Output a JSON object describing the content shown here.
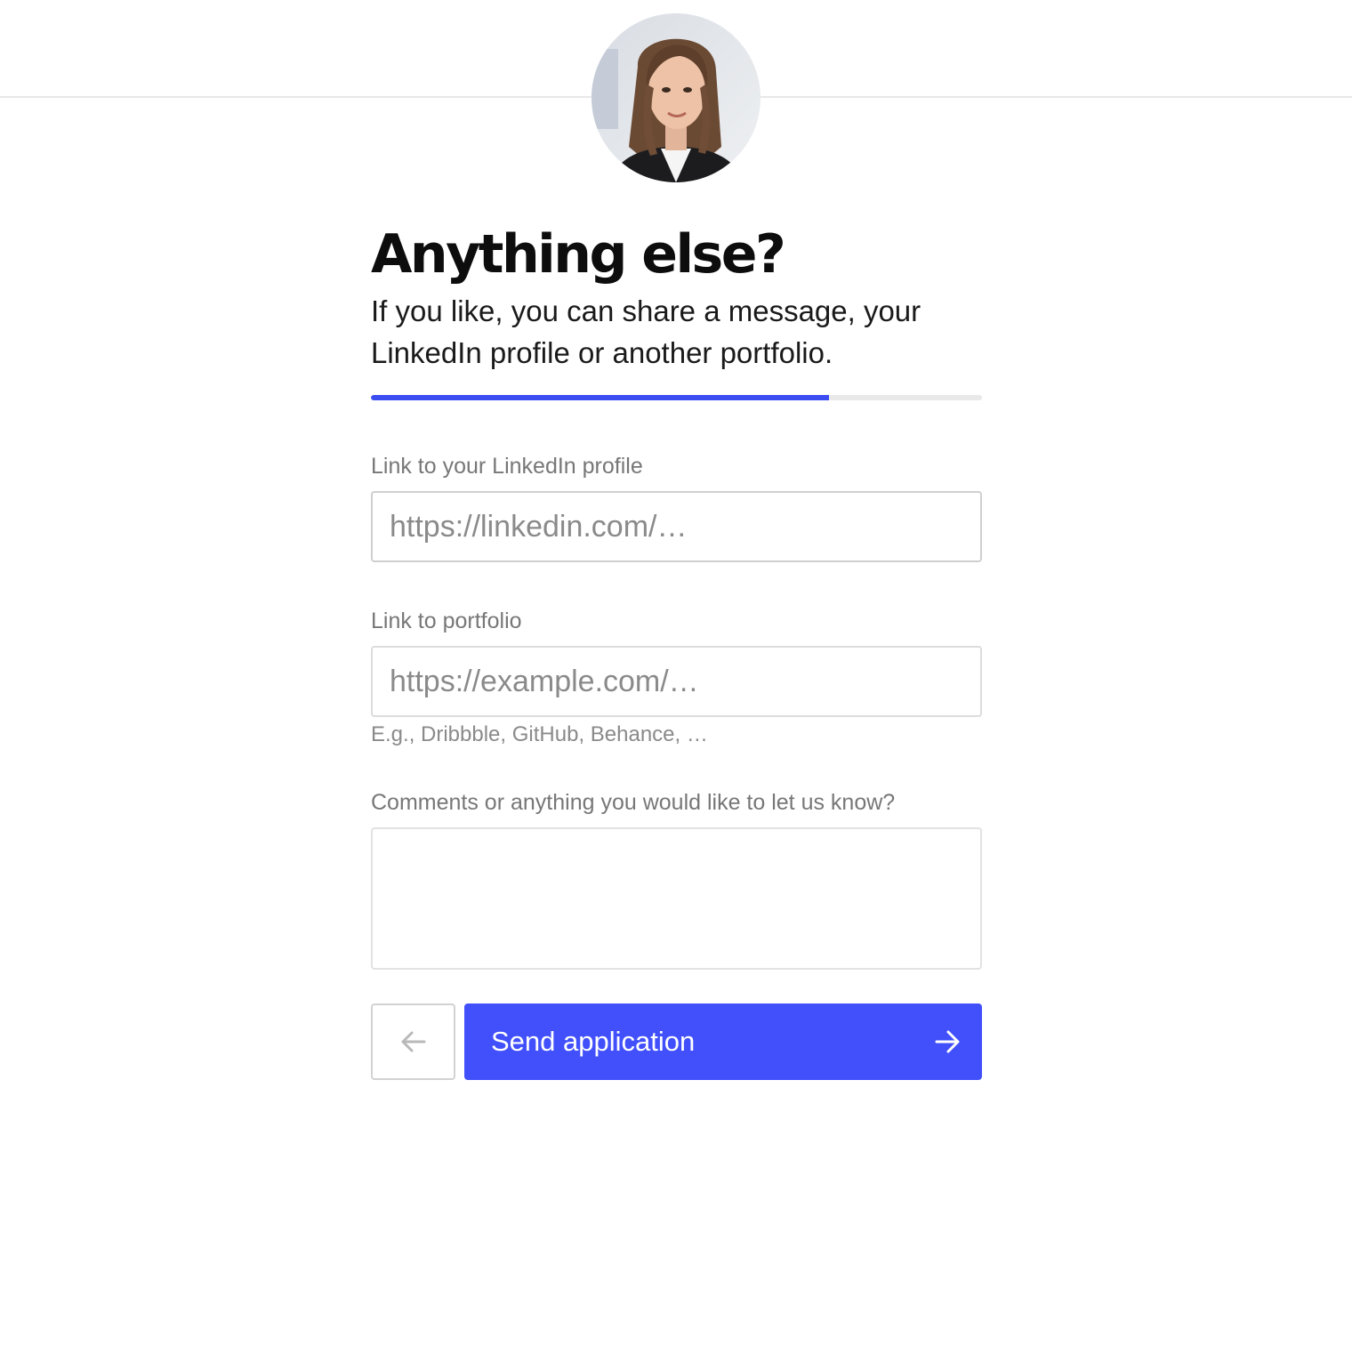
{
  "header": {
    "avatar_alt": "Recruiter portrait"
  },
  "form": {
    "title": "Anything else?",
    "subtitle": "If you like, you can share a message, your LinkedIn profile or another portfolio.",
    "progress_fraction": 0.75,
    "linkedin": {
      "label": "Link to your LinkedIn profile",
      "placeholder": "https://linkedin.com/…",
      "value": ""
    },
    "portfolio": {
      "label": "Link to portfolio",
      "placeholder": "https://example.com/…",
      "value": "",
      "hint": "E.g., Dribbble, GitHub, Behance, …"
    },
    "comments": {
      "label": "Comments or anything you would like to let us know?",
      "value": ""
    },
    "back_icon": "arrow-left-icon",
    "send_label": "Send application",
    "send_icon": "arrow-right-icon"
  },
  "colors": {
    "accent": "#4150fb",
    "progress_fill": "#3b4df0",
    "progress_track": "#e9e9e9",
    "label_text": "#777777"
  }
}
